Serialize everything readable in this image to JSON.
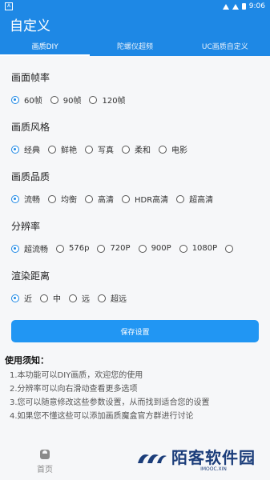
{
  "statusbar": {
    "time": "9:06",
    "left_icon": "A"
  },
  "header": {
    "title": "自定义"
  },
  "tabs": [
    {
      "label": "画质DIY"
    },
    {
      "label": "陀螺仪超频"
    },
    {
      "label": "UC画质自定义"
    }
  ],
  "sections": {
    "framerate": {
      "title": "画面帧率",
      "options": [
        "60帧",
        "90帧",
        "120帧"
      ],
      "selected": "60帧"
    },
    "style": {
      "title": "画质风格",
      "options": [
        "经典",
        "鲜艳",
        "写真",
        "柔和",
        "电影"
      ],
      "selected": "经典"
    },
    "quality": {
      "title": "画质品质",
      "options": [
        "流畅",
        "均衡",
        "高清",
        "HDR高清",
        "超高清"
      ],
      "selected": "流畅"
    },
    "resolution": {
      "title": "分辨率",
      "options": [
        "超流畅",
        "576p",
        "720P",
        "900P",
        "1080P"
      ],
      "selected": "超流畅"
    },
    "distance": {
      "title": "渲染距离",
      "options": [
        "近",
        "中",
        "远",
        "超远"
      ],
      "selected": "近"
    }
  },
  "save_button": {
    "label": "保存设置"
  },
  "notes": {
    "title": "使用须知：",
    "items": [
      "1.本功能可以DIY画质，欢迎您的使用",
      "2.分辨率可以向右滑动查看更多选项",
      "3.您可以随意修改这些参数设置，从而找到适合您的设置",
      "4.如果您不懂这些可以添加画质魔盒官方群进行讨论"
    ]
  },
  "bottom_nav": {
    "home_label": "首页"
  },
  "watermark": {
    "text": "陌客软件园",
    "sub": "IMOOC.XIN"
  },
  "colors": {
    "primary": "#1e88e5",
    "button": "#2196f3"
  }
}
